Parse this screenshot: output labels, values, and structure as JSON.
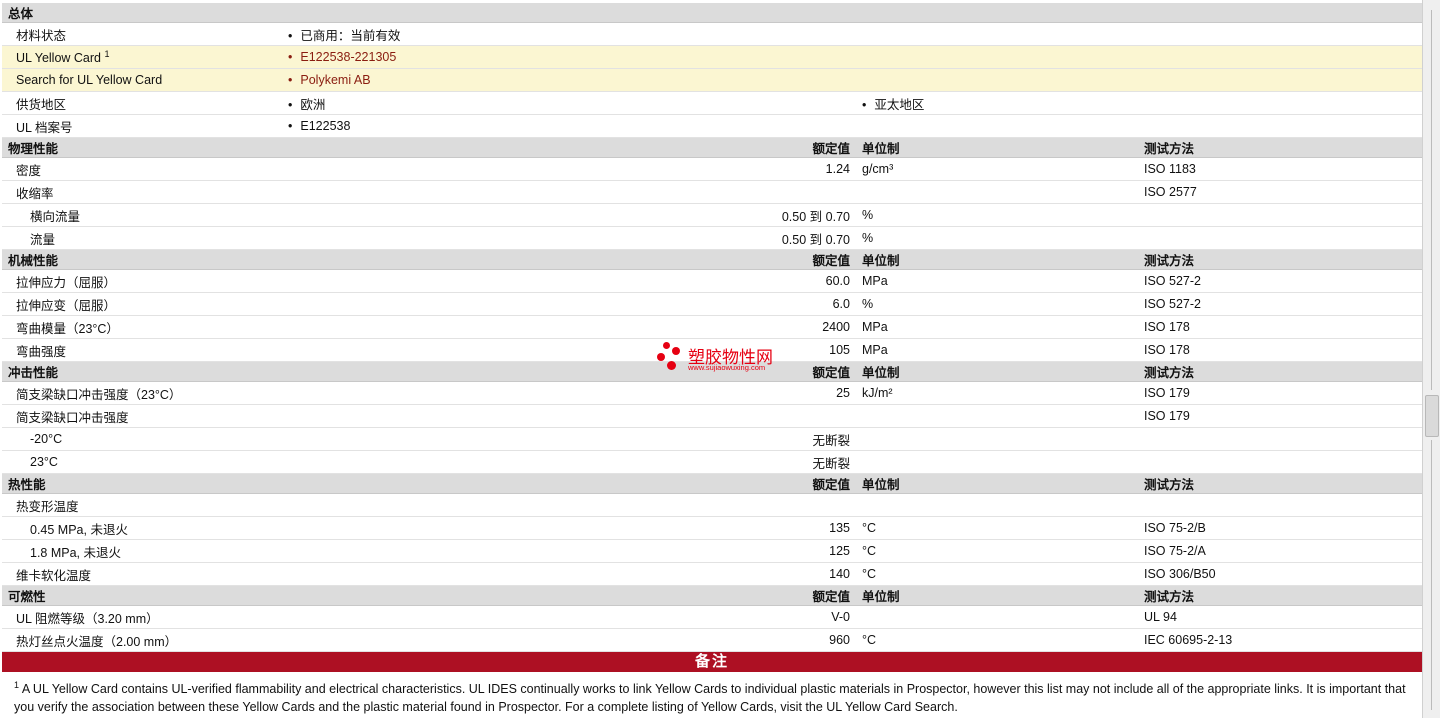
{
  "general": {
    "heading": "总体",
    "rows": [
      {
        "label": "材料状态",
        "value": "已商用：当前有效"
      },
      {
        "label": "UL Yellow Card",
        "sup": "1",
        "value": "E122538-221305"
      },
      {
        "label": "Search for UL Yellow Card",
        "value": "Polykemi AB"
      },
      {
        "label": "供货地区",
        "value": "欧洲",
        "value2": "亚太地区"
      },
      {
        "label": "UL 档案号",
        "value": "E122538"
      }
    ]
  },
  "headers": {
    "nominal": "额定值",
    "unit": "单位制",
    "method": "测试方法",
    "to": "到"
  },
  "sections": {
    "physical": {
      "title": "物理性能",
      "rows": [
        {
          "label": "密度",
          "value": "1.24",
          "unit": "g/cm³",
          "method": "ISO 1183"
        },
        {
          "label": "收缩率",
          "value": "",
          "unit": "",
          "method": "ISO 2577"
        },
        {
          "label": "横向流量",
          "from": "0.50",
          "to_val": "0.70",
          "unit": "%",
          "method": ""
        },
        {
          "label": "流量",
          "from": "0.50",
          "to_val": "0.70",
          "unit": "%",
          "method": ""
        }
      ]
    },
    "mechanical": {
      "title": "机械性能",
      "rows": [
        {
          "label": "拉伸应力（屈服）",
          "value": "60.0",
          "unit": "MPa",
          "method": "ISO 527-2"
        },
        {
          "label": "拉伸应变（屈服）",
          "value": "6.0",
          "unit": "%",
          "method": "ISO 527-2"
        },
        {
          "label": "弯曲模量（23°C）",
          "value": "2400",
          "unit": "MPa",
          "method": "ISO 178"
        },
        {
          "label": "弯曲强度",
          "value": "105",
          "unit": "MPa",
          "method": "ISO 178"
        }
      ]
    },
    "impact": {
      "title": "冲击性能",
      "rows": [
        {
          "label": "简支梁缺口冲击强度（23°C）",
          "value": "25",
          "unit": "kJ/m²",
          "method": "ISO 179"
        },
        {
          "label": "简支梁缺口冲击强度",
          "value": "",
          "unit": "",
          "method": "ISO 179"
        },
        {
          "label": "-20°C",
          "value": "无断裂",
          "unit": "",
          "method": ""
        },
        {
          "label": "23°C",
          "value": "无断裂",
          "unit": "",
          "method": ""
        }
      ]
    },
    "thermal": {
      "title": "热性能",
      "rows": [
        {
          "label": "热变形温度",
          "value": "",
          "unit": "",
          "method": ""
        },
        {
          "label": "0.45 MPa, 未退火",
          "value": "135",
          "unit": "°C",
          "method": "ISO 75-2/B"
        },
        {
          "label": "1.8 MPa, 未退火",
          "value": "125",
          "unit": "°C",
          "method": "ISO 75-2/A"
        },
        {
          "label": "维卡软化温度",
          "value": "140",
          "unit": "°C",
          "method": "ISO 306/B50"
        }
      ]
    },
    "flammability": {
      "title": "可燃性",
      "rows": [
        {
          "label": "UL 阻燃等级（3.20 mm）",
          "value": "V-0",
          "unit": "",
          "method": "UL 94"
        },
        {
          "label": "热灯丝点火温度（2.00 mm）",
          "value": "960",
          "unit": "°C",
          "method": "IEC 60695-2-13"
        }
      ]
    }
  },
  "notes": {
    "title": "备注",
    "sup": "1",
    "text": "A UL Yellow Card contains UL-verified flammability and electrical characteristics. UL IDES continually works to link Yellow Cards to individual plastic materials in Prospector, however this list may not include all of the appropriate links. It is important that you verify the association between these Yellow Cards and the plastic material found in Prospector. For a complete listing of Yellow Cards, visit the UL Yellow Card Search."
  },
  "watermark": {
    "title": "塑胶物性网",
    "url": "www.sujiaowuxing.com"
  }
}
